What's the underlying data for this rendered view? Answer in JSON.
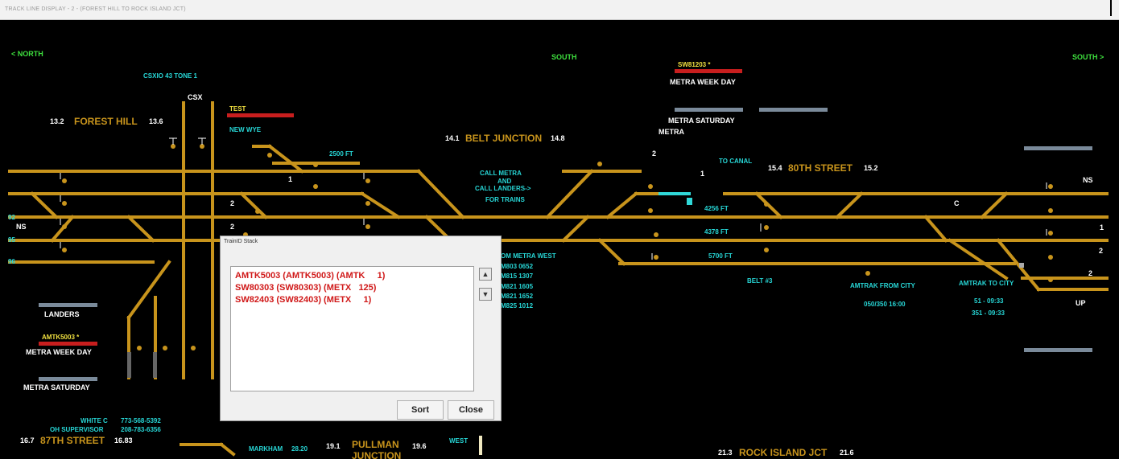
{
  "window": {
    "title": "TRACK LINE DISPLAY - 2 - (FOREST HILL TO ROCK ISLAND JCT)"
  },
  "nav": {
    "north": "< NORTH",
    "south_mid": "SOUTH",
    "south_right": "SOUTH >"
  },
  "stations": {
    "forest_hill": {
      "start": "13.2",
      "name": "FOREST HILL",
      "end": "13.6"
    },
    "belt_junction": {
      "start": "14.1",
      "name": "BELT JUNCTION",
      "end": "14.8"
    },
    "eightieth_street": {
      "start": "15.4",
      "name": "80TH STREET",
      "end": "15.2"
    },
    "eighty_seventh_street": {
      "start": "16.7",
      "name": "87TH STREET",
      "end": "16.83"
    },
    "pullman_junction": {
      "start": "19.1",
      "name": "PULLMAN",
      "name2": "JUNCTION",
      "end": "19.6"
    },
    "rock_island_jct": {
      "start": "21.3",
      "name": "ROCK ISLAND JCT",
      "end": "21.6"
    }
  },
  "labels": {
    "csx_tone": "CSXIO 43 TONE 1",
    "csx": "CSX",
    "test": "TEST",
    "new_wye": "NEW WYE",
    "ft_2500": "2500 FT",
    "call_metra_1": "CALL METRA",
    "call_metra_2": "AND",
    "call_metra_3": "CALL LANDERS->",
    "call_metra_4": "FOR TRAINS",
    "sw81203": "SW81203 *",
    "metra_week_day_top": "METRA WEEK DAY",
    "metra_saturday_top": "METRA SATURDAY",
    "metra": "METRA",
    "to_canal": "TO CANAL",
    "num_2_top": "2",
    "num_1_top": "1",
    "ft_4256": "4256 FT",
    "ft_4378": "4378 FT",
    "ft_5700": "5700 FT",
    "c_label": "C",
    "ns_right": "NS",
    "right_1": "1",
    "right_2": "2",
    "right_2b": "2",
    "up": "UP",
    "ns_left": "NS",
    "track_92": "92",
    "track_95": "95",
    "track_96": "96",
    "num_1_left": "1",
    "num_2_left": "2",
    "num_2_left2": "2",
    "belt_3": "BELT #3",
    "amtrak_from": "AMTRAK FROM CITY",
    "amtrak_from_time": "050/350 16:00",
    "amtrak_to": "AMTRAK TO CITY",
    "amtrak_to_t1": "51 - 09:33",
    "amtrak_to_t2": "351 - 09:33",
    "om_metra_west": "OM METRA WEST",
    "metra_rows": [
      "M803 0652",
      "M815 1307",
      "M821 1605",
      "M821 1652",
      "M825 1012"
    ],
    "landers": "LANDERS",
    "amtk5003": "AMTK5003 *",
    "metra_week_day_left": "METRA WEEK DAY",
    "metra_saturday_left": "METRA SATURDAY",
    "white_c": "WHITE C",
    "white_c_phone": "773-568-5392",
    "oh_supervisor": "OH SUPERVISOR",
    "oh_phone": "208-783-6356",
    "markham": "MARKHAM",
    "markham_num": "28.20",
    "west": "WEST"
  },
  "dialog": {
    "title": "TrainID Stack",
    "items": [
      "AMTK5003 (AMTK5003) (AMTK     1)",
      "SW80303 (SW80303) (METX   125)",
      "SW82403 (SW82403) (METX     1)"
    ],
    "sort_label": "Sort",
    "close_label": "Close",
    "up_glyph": "▲",
    "down_glyph": "▼"
  },
  "colors": {
    "track": "#c8941c",
    "signal": "#c8941c",
    "occupied": "#30d8d8",
    "accent_green": "#3ee03e"
  }
}
